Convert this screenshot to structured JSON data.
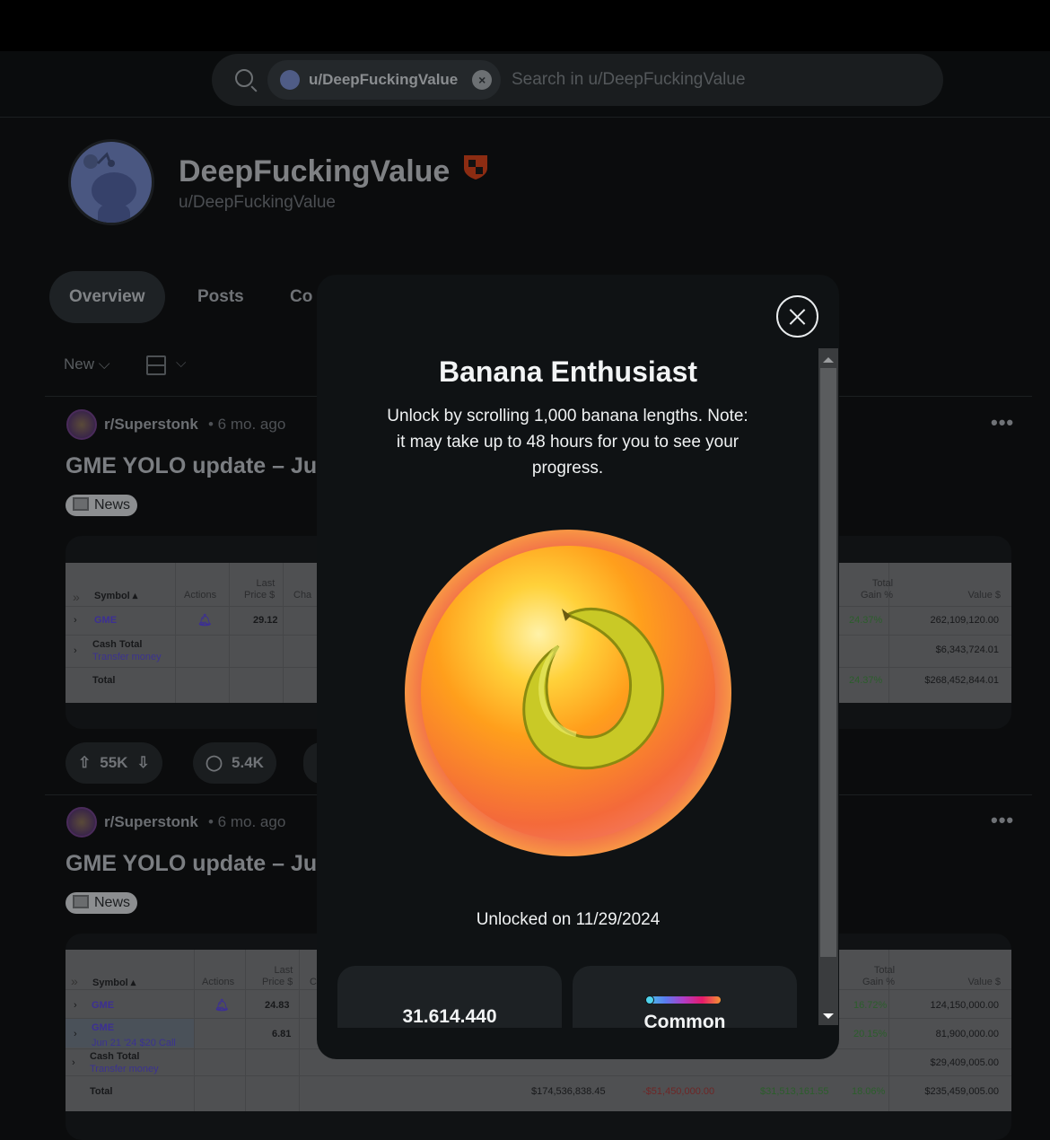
{
  "search": {
    "chip_label": "u/DeepFuckingValue",
    "placeholder": "Search in u/DeepFuckingValue"
  },
  "profile": {
    "display_name": "DeepFuckingValue",
    "username": "u/DeepFuckingValue"
  },
  "tabs": [
    {
      "label": "Overview",
      "active": true
    },
    {
      "label": "Posts"
    },
    {
      "label": "Co"
    }
  ],
  "sort": {
    "label": "New"
  },
  "posts": [
    {
      "subreddit": "r/Superstonk",
      "age": "• 6 mo. ago",
      "title": "GME YOLO update – Jur",
      "flair": "News",
      "upvotes": "55K",
      "comments": "5.4K",
      "table": {
        "headers": {
          "symbol": "Symbol ▴",
          "actions": "Actions",
          "last_price": "Last\nPrice $",
          "change": "Cha",
          "total_gain": "Total\nGain %",
          "value": "Value $"
        },
        "rows": [
          {
            "symbol": "GME",
            "last_price": "29.12",
            "total_gain": "24.37%",
            "value": "262,109,120.00"
          },
          {
            "symbol": "Cash Total",
            "sub": "Transfer money",
            "value": "$6,343,724.01"
          },
          {
            "symbol": "Total",
            "total_gain": "24.37%",
            "value": "$268,452,844.01"
          }
        ]
      }
    },
    {
      "subreddit": "r/Superstonk",
      "age": "• 6 mo. ago",
      "title": "GME YOLO update – Jur",
      "flair": "News",
      "table": {
        "headers": {
          "symbol": "Symbol ▴",
          "actions": "Actions",
          "last_price": "Last\nPrice $",
          "change": "C",
          "total_gain": "Total\nGain %",
          "value": "Value $"
        },
        "rows": [
          {
            "symbol": "GME",
            "last_price": "24.83",
            "total_gain": "16.72%",
            "value": "124,150,000.00"
          },
          {
            "symbol": "GME",
            "sub": "Jun 21 '24 $20 Call",
            "last_price": "6.81",
            "total_gain": "20.15%",
            "value": "81,900,000.00"
          },
          {
            "symbol": "Cash Total",
            "sub": "Transfer money",
            "value": "$29,409,005.00"
          },
          {
            "symbol": "Total",
            "cost": "$174,536,838.45",
            "day_gain": "-$51,450,000.00",
            "total_gain_amt": "$31,513,161.55",
            "total_gain": "18.06%",
            "value": "$235,459,005.00"
          }
        ]
      }
    }
  ],
  "modal": {
    "title": "Banana Enthusiast",
    "description": "Unlock by scrolling 1,000 banana lengths. Note: it may take up to 48 hours for you to see your progress.",
    "unlocked": "Unlocked on 11/29/2024",
    "stat": "31.614.440",
    "rarity": "Common"
  },
  "colors": {
    "gain_green": "#2b5e2b",
    "loss_red": "#6e2626",
    "link_purple": "#3c2f94",
    "shield": "#c2410c"
  }
}
